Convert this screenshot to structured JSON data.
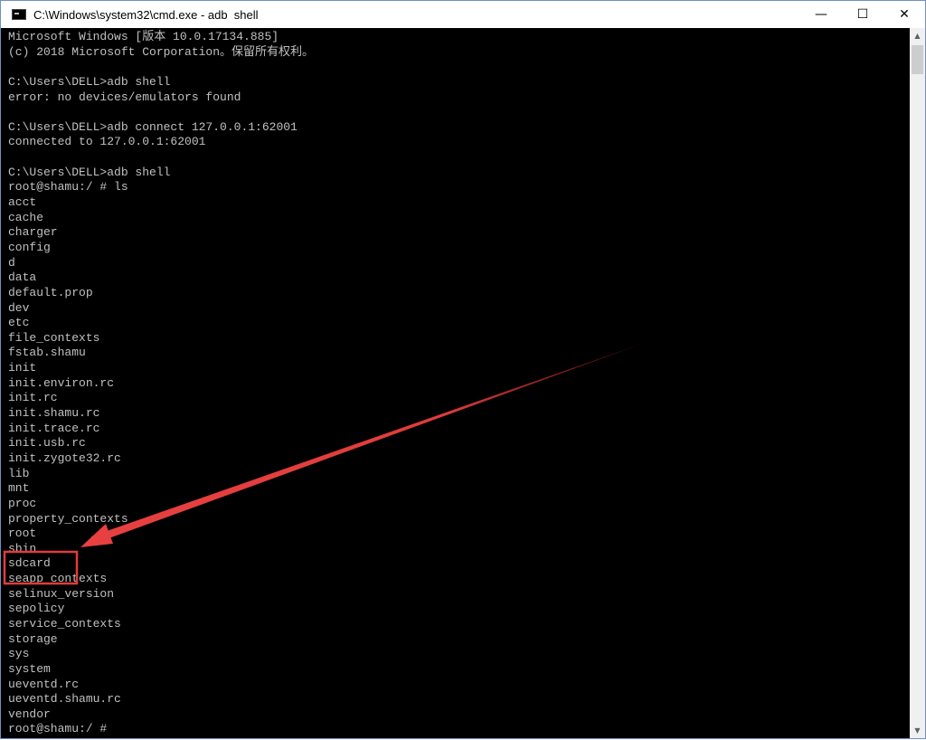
{
  "window": {
    "title": "C:\\Windows\\system32\\cmd.exe - adb  shell",
    "minimize_glyph": "—",
    "maximize_glyph": "☐",
    "close_glyph": "✕",
    "icon": "cmd-icon"
  },
  "terminal": {
    "lines": [
      "Microsoft Windows [版本 10.0.17134.885]",
      "(c) 2018 Microsoft Corporation。保留所有权利。",
      "",
      "C:\\Users\\DELL>adb shell",
      "error: no devices/emulators found",
      "",
      "C:\\Users\\DELL>adb connect 127.0.0.1:62001",
      "connected to 127.0.0.1:62001",
      "",
      "C:\\Users\\DELL>adb shell",
      "root@shamu:/ # ls",
      "acct",
      "cache",
      "charger",
      "config",
      "d",
      "data",
      "default.prop",
      "dev",
      "etc",
      "file_contexts",
      "fstab.shamu",
      "init",
      "init.environ.rc",
      "init.rc",
      "init.shamu.rc",
      "init.trace.rc",
      "init.usb.rc",
      "init.zygote32.rc",
      "lib",
      "mnt",
      "proc",
      "property_contexts",
      "root",
      "sbin",
      "sdcard",
      "seapp_contexts",
      "selinux_version",
      "sepolicy",
      "service_contexts",
      "storage",
      "sys",
      "system",
      "ueventd.rc",
      "ueventd.shamu.rc",
      "vendor",
      "root@shamu:/ #"
    ]
  },
  "annotation": {
    "highlight_color": "#e03c3c"
  }
}
